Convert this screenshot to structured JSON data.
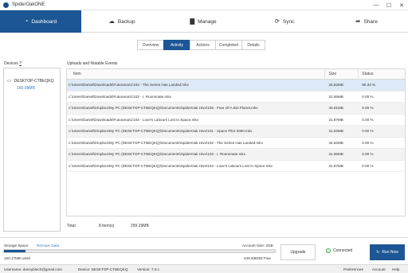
{
  "window": {
    "title": "SpiderOakONE",
    "controls": {
      "minimize": "—",
      "maximize": "☐",
      "close": "✕"
    }
  },
  "nav": {
    "items": [
      {
        "label": "Dashboard",
        "icon": "dashboard-icon",
        "glyph": "◔"
      },
      {
        "label": "Backup",
        "icon": "cloud-upload-icon",
        "glyph": "☁"
      },
      {
        "label": "Manage",
        "icon": "folder-icon",
        "glyph": "▇"
      },
      {
        "label": "Sync",
        "icon": "sync-icon",
        "glyph": "⟳"
      },
      {
        "label": "Share",
        "icon": "share-icon",
        "glyph": "➦"
      }
    ]
  },
  "subtabs": [
    "Overview",
    "Activity",
    "Actions",
    "Completed",
    "Details"
  ],
  "devices": {
    "label": "Devices",
    "help": "?",
    "items": [
      {
        "name": "DESKTOP-CTBEQKQ",
        "size": "160.09MB",
        "glyph": "▭"
      }
    ]
  },
  "uploads": {
    "label": "Uploads and Notable Events",
    "headers": {
      "item": "Item",
      "size": "Size",
      "status": "Status"
    },
    "rows": [
      {
        "item": "c:\\Users\\Daniel\\Downloads\\Futurama\\1\\102 - The Series Has Landed.mkv",
        "size": "34.82MB",
        "status": "90.34 %"
      },
      {
        "item": "c:\\Users\\Daniel\\Downloads\\Futurama\\1\\103 - I, Roommate.mkv",
        "size": "31.55MB",
        "status": "0.00 %"
      },
      {
        "item": "c:\\Users\\Daniel\\Dropbox\\My PC (DESKTOP-CTBEQKQ)\\Documents\\SpiderOak Hive\\105 - Fear Of A Bot Planet.mkv",
        "size": "30.91MB",
        "status": "0.00 %"
      },
      {
        "item": "c:\\Users\\Daniel\\Downloads\\Futurama\\1\\104 - Love's Labours Lost In Space.mkv",
        "size": "31.87MB",
        "status": "0.00 %"
      },
      {
        "item": "c:\\Users\\Daniel\\Dropbox\\My PC (DESKTOP-CTBEQKQ)\\Documents\\SpiderOak Hive\\101 - Space Pilot 3000.mkv",
        "size": "31.82MB",
        "status": "0.00 %"
      },
      {
        "item": "c:\\Users\\Daniel\\Dropbox\\My PC (DESKTOP-CTBEQKQ)\\Documents\\SpiderOak Hive\\102 - The Series Has Landed.mkv",
        "size": "34.82MB",
        "status": "0.00 %"
      },
      {
        "item": "c:\\Users\\Daniel\\Dropbox\\My PC (DESKTOP-CTBEQKQ)\\Documents\\SpiderOak Hive\\103 - I, Roommate.mkv",
        "size": "31.55MB",
        "status": "0.00 %"
      },
      {
        "item": "c:\\Users\\Daniel\\Dropbox\\My PC (DESKTOP-CTBEQKQ)\\Documents\\SpiderOak Hive\\104 - Love's Labours Lost In Space.mkv",
        "size": "31.87MB",
        "status": "0.00 %"
      }
    ],
    "total_label": "Total:",
    "total_items": "8 item(s)",
    "total_size": "259.29MB"
  },
  "storage": {
    "label": "Storage Space",
    "remove_data": "Remove Data",
    "account_size": "Account Size: 2GB",
    "used": "160.17MB Used",
    "free": "249.938GB Free",
    "used_fraction": 0.08
  },
  "actions": {
    "upgrade": "Upgrade",
    "connected": "Connected",
    "run_now": "Run Now"
  },
  "statusbar": {
    "username": "Username: dannyblech@gmail.com",
    "device": "Device: DESKTOP-CTBEQKQ",
    "version": "Version: 7.5.1",
    "links": [
      "Preferences",
      "Account",
      "Help"
    ]
  },
  "colors": {
    "accent": "#1c5694",
    "link": "#3a78c2",
    "connected": "#3aa24a"
  }
}
